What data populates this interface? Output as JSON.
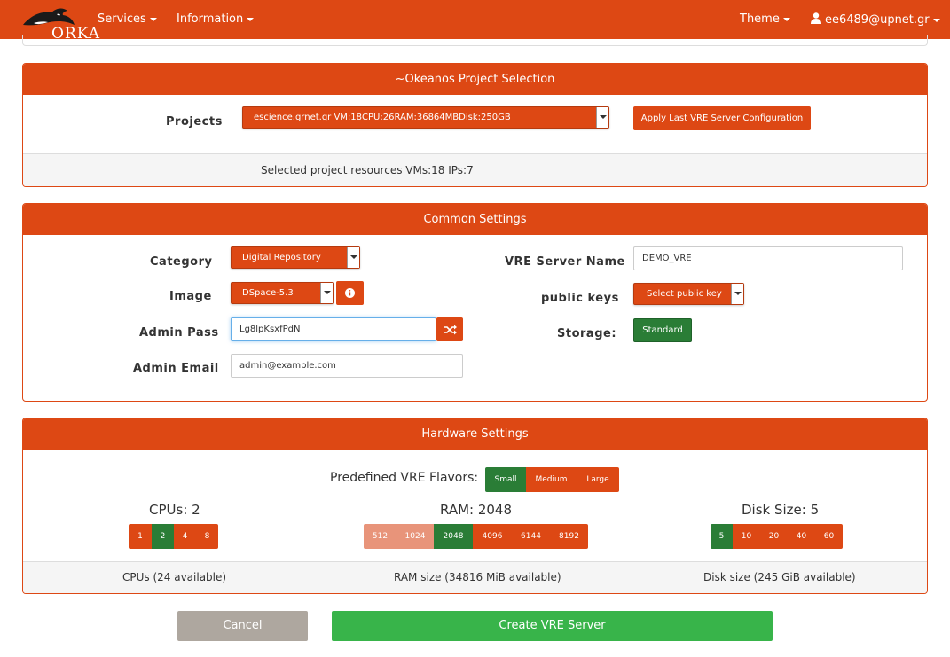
{
  "navbar": {
    "logo_text": "ORKA",
    "services": "Services",
    "information": "Information",
    "theme": "Theme",
    "user": "ee6489@upnet.gr"
  },
  "project_panel": {
    "title": "~Okeanos Project Selection",
    "projects_label": "Projects",
    "selected_project": "escience.grnet.gr VM:18CPU:26RAM:36864MBDisk:250GB",
    "apply_button": "Apply Last VRE Server Configuration",
    "footer": "Selected project resources VMs:18 IPs:7"
  },
  "common_panel": {
    "title": "Common Settings",
    "category_label": "Category",
    "category_value": "Digital Repository",
    "image_label": "Image",
    "image_value": "DSpace-5.3",
    "admin_pass_label": "Admin Pass",
    "admin_pass_value": "Lg8lpKsxfPdN",
    "admin_email_label": "Admin Email",
    "admin_email_value": "admin@example.com",
    "vre_name_label": "VRE Server Name",
    "vre_name_value": "DEMO_VRE",
    "public_keys_label": "public keys",
    "public_keys_value": "Select public key",
    "storage_label": "Storage:",
    "storage_value": "Standard"
  },
  "hardware_panel": {
    "title": "Hardware Settings",
    "flavors_label": "Predefined VRE Flavors:",
    "flavors": [
      {
        "label": "Small",
        "selected": true
      },
      {
        "label": "Medium",
        "selected": false
      },
      {
        "label": "Large",
        "selected": false
      }
    ],
    "cpus_title": "CPUs: 2",
    "cpu_options": [
      {
        "label": "1",
        "state": "normal"
      },
      {
        "label": "2",
        "state": "active"
      },
      {
        "label": "4",
        "state": "normal"
      },
      {
        "label": "8",
        "state": "normal"
      }
    ],
    "ram_title": "RAM: 2048",
    "ram_options": [
      {
        "label": "512",
        "state": "disabled"
      },
      {
        "label": "1024",
        "state": "disabled"
      },
      {
        "label": "2048",
        "state": "active"
      },
      {
        "label": "4096",
        "state": "normal"
      },
      {
        "label": "6144",
        "state": "normal"
      },
      {
        "label": "8192",
        "state": "normal"
      }
    ],
    "disk_title": "Disk Size: 5",
    "disk_options": [
      {
        "label": "5",
        "state": "active"
      },
      {
        "label": "10",
        "state": "normal"
      },
      {
        "label": "20",
        "state": "normal"
      },
      {
        "label": "40",
        "state": "normal"
      },
      {
        "label": "60",
        "state": "normal"
      }
    ],
    "cpus_footer": "CPUs (24 available)",
    "ram_footer": "RAM size (34816 MiB available)",
    "disk_footer": "Disk size (245 GiB available)"
  },
  "actions": {
    "cancel": "Cancel",
    "create": "Create VRE Server"
  },
  "colors": {
    "brand": "#dd4814",
    "active": "#2a7d36",
    "create": "#38b44a",
    "cancel": "#aea79f"
  }
}
